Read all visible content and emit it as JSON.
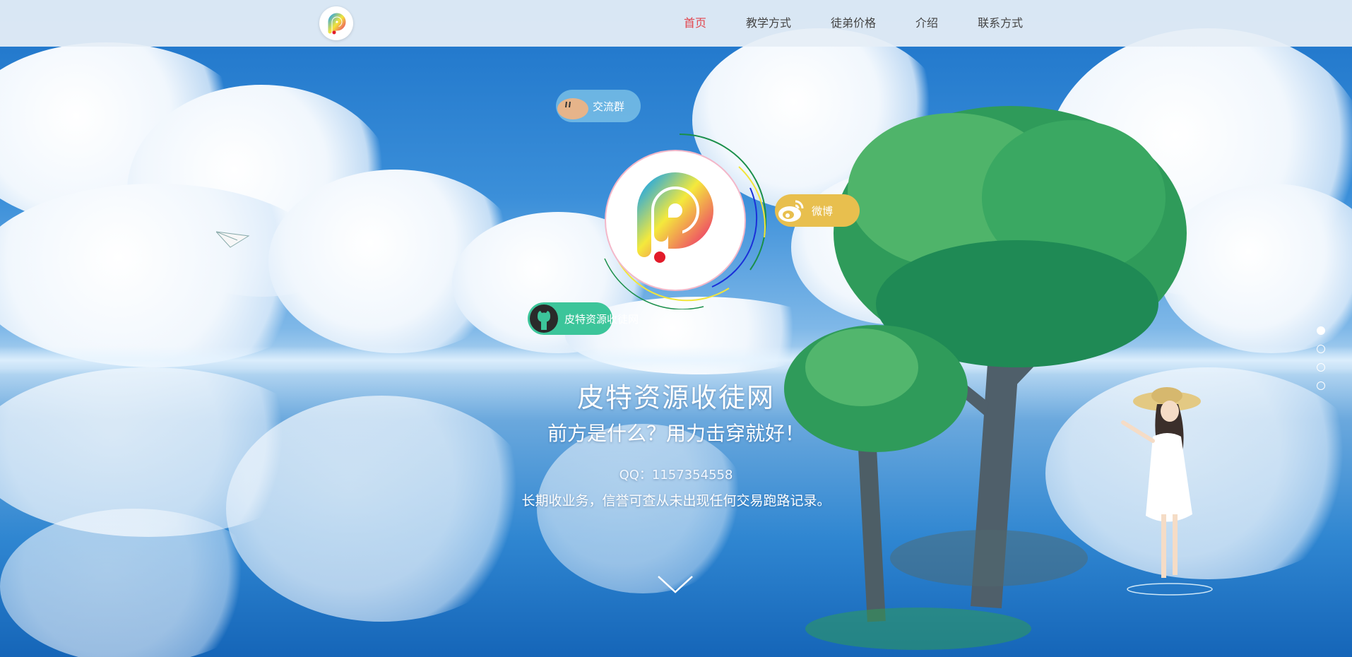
{
  "nav": {
    "items": [
      {
        "label": "首页",
        "active": true
      },
      {
        "label": "教学方式",
        "active": false
      },
      {
        "label": "徒弟价格",
        "active": false
      },
      {
        "label": "介绍",
        "active": false
      },
      {
        "label": "联系方式",
        "active": false
      }
    ],
    "active_color": "#e2464e"
  },
  "badges": {
    "group": {
      "label": "交流群",
      "icon": "chat-avatar-icon"
    },
    "weibo": {
      "label": "微博",
      "icon": "weibo-icon"
    },
    "github": {
      "label": "皮特资源收徒网",
      "icon": "github-icon"
    }
  },
  "hero": {
    "title": "皮特资源收徒网",
    "slogan": "前方是什么？用力击穿就好！",
    "qq": "QQ：1157354558",
    "description": "长期收业务，信誉可查从未出现任何交易跑路记录。"
  },
  "pagination": {
    "count": 4,
    "active_index": 0
  },
  "colors": {
    "weibo": "#e8bf4e",
    "github": "#3cc59a",
    "group": "#78bee6"
  }
}
